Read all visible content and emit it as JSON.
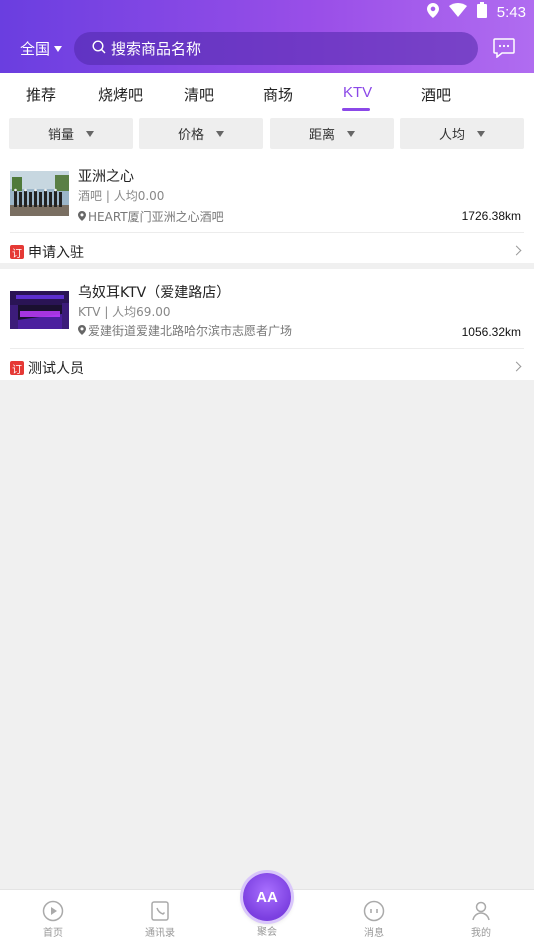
{
  "status": {
    "time": "5:43"
  },
  "header": {
    "location": "全国",
    "search_placeholder": "搜索商品名称"
  },
  "tabs": [
    {
      "label": "推荐"
    },
    {
      "label": "烧烤吧"
    },
    {
      "label": "清吧"
    },
    {
      "label": "商场"
    },
    {
      "label": "KTV"
    },
    {
      "label": "酒吧"
    }
  ],
  "filters": [
    {
      "label": "销量"
    },
    {
      "label": "价格"
    },
    {
      "label": "距离"
    },
    {
      "label": "人均"
    }
  ],
  "stores": [
    {
      "name": "亚洲之心",
      "category": "酒吧",
      "avg": "人均0.00",
      "address": "HEART厦门亚洲之心酒吧",
      "distance": "1726.38km",
      "order_badge": "订",
      "order_label": "申请入驻"
    },
    {
      "name": "乌奴耳KTV（爱建路店）",
      "category": "KTV",
      "avg": "人均69.00",
      "address": "爱建街道爱建北路哈尔滨市志愿者广场",
      "distance": "1056.32km",
      "order_badge": "订",
      "order_label": "测试人员"
    }
  ],
  "bottom_nav": {
    "home": "首页",
    "contacts": "通讯录",
    "center": "聚会",
    "center_logo": "AA",
    "messages": "消息",
    "mine": "我的"
  },
  "colors": {
    "accent": "#8b48e8",
    "header_start": "#6a3ee0",
    "header_end": "#b06cf0",
    "badge": "#e53935"
  }
}
